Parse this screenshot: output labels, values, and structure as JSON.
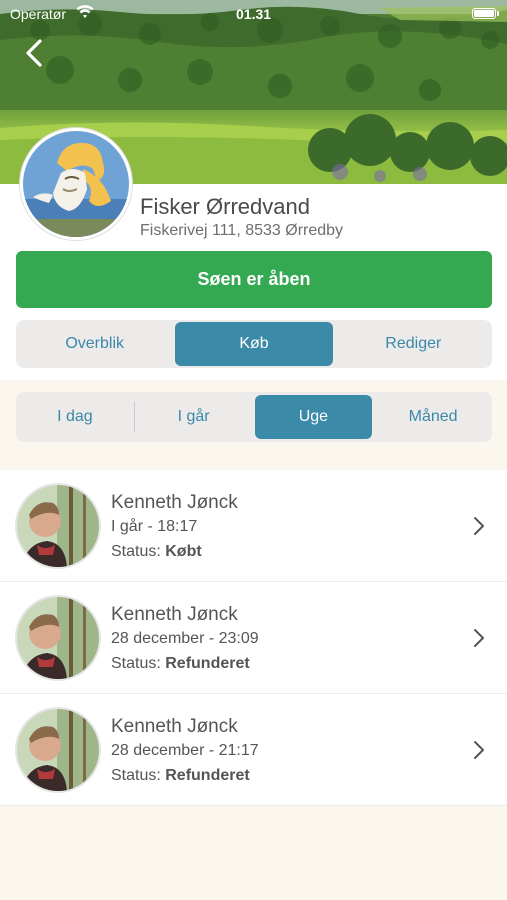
{
  "status_bar": {
    "carrier": "Operatør",
    "time": "01.31"
  },
  "profile": {
    "name": "Fisker Ørredvand",
    "address": "Fiskerivej 111, 8533 Ørredby"
  },
  "lake_status_button": "Søen er åben",
  "main_tabs": [
    {
      "label": "Overblik",
      "active": false
    },
    {
      "label": "Køb",
      "active": true
    },
    {
      "label": "Rediger",
      "active": false
    }
  ],
  "period_tabs": [
    {
      "label": "I dag",
      "active": false
    },
    {
      "label": "I går",
      "active": false
    },
    {
      "label": "Uge",
      "active": true
    },
    {
      "label": "Måned",
      "active": false
    }
  ],
  "purchases": [
    {
      "name": "Kenneth Jønck",
      "date": "I går - 18:17",
      "status_label": "Status:",
      "status": "Købt"
    },
    {
      "name": "Kenneth Jønck",
      "date": "28 december - 23:09",
      "status_label": "Status:",
      "status": "Refunderet"
    },
    {
      "name": "Kenneth Jønck",
      "date": "28 december - 21:17",
      "status_label": "Status:",
      "status": "Refunderet"
    }
  ],
  "colors": {
    "accent_green": "#35a852",
    "accent_teal": "#3a8aa8",
    "cream_background": "#fbf7ee"
  }
}
